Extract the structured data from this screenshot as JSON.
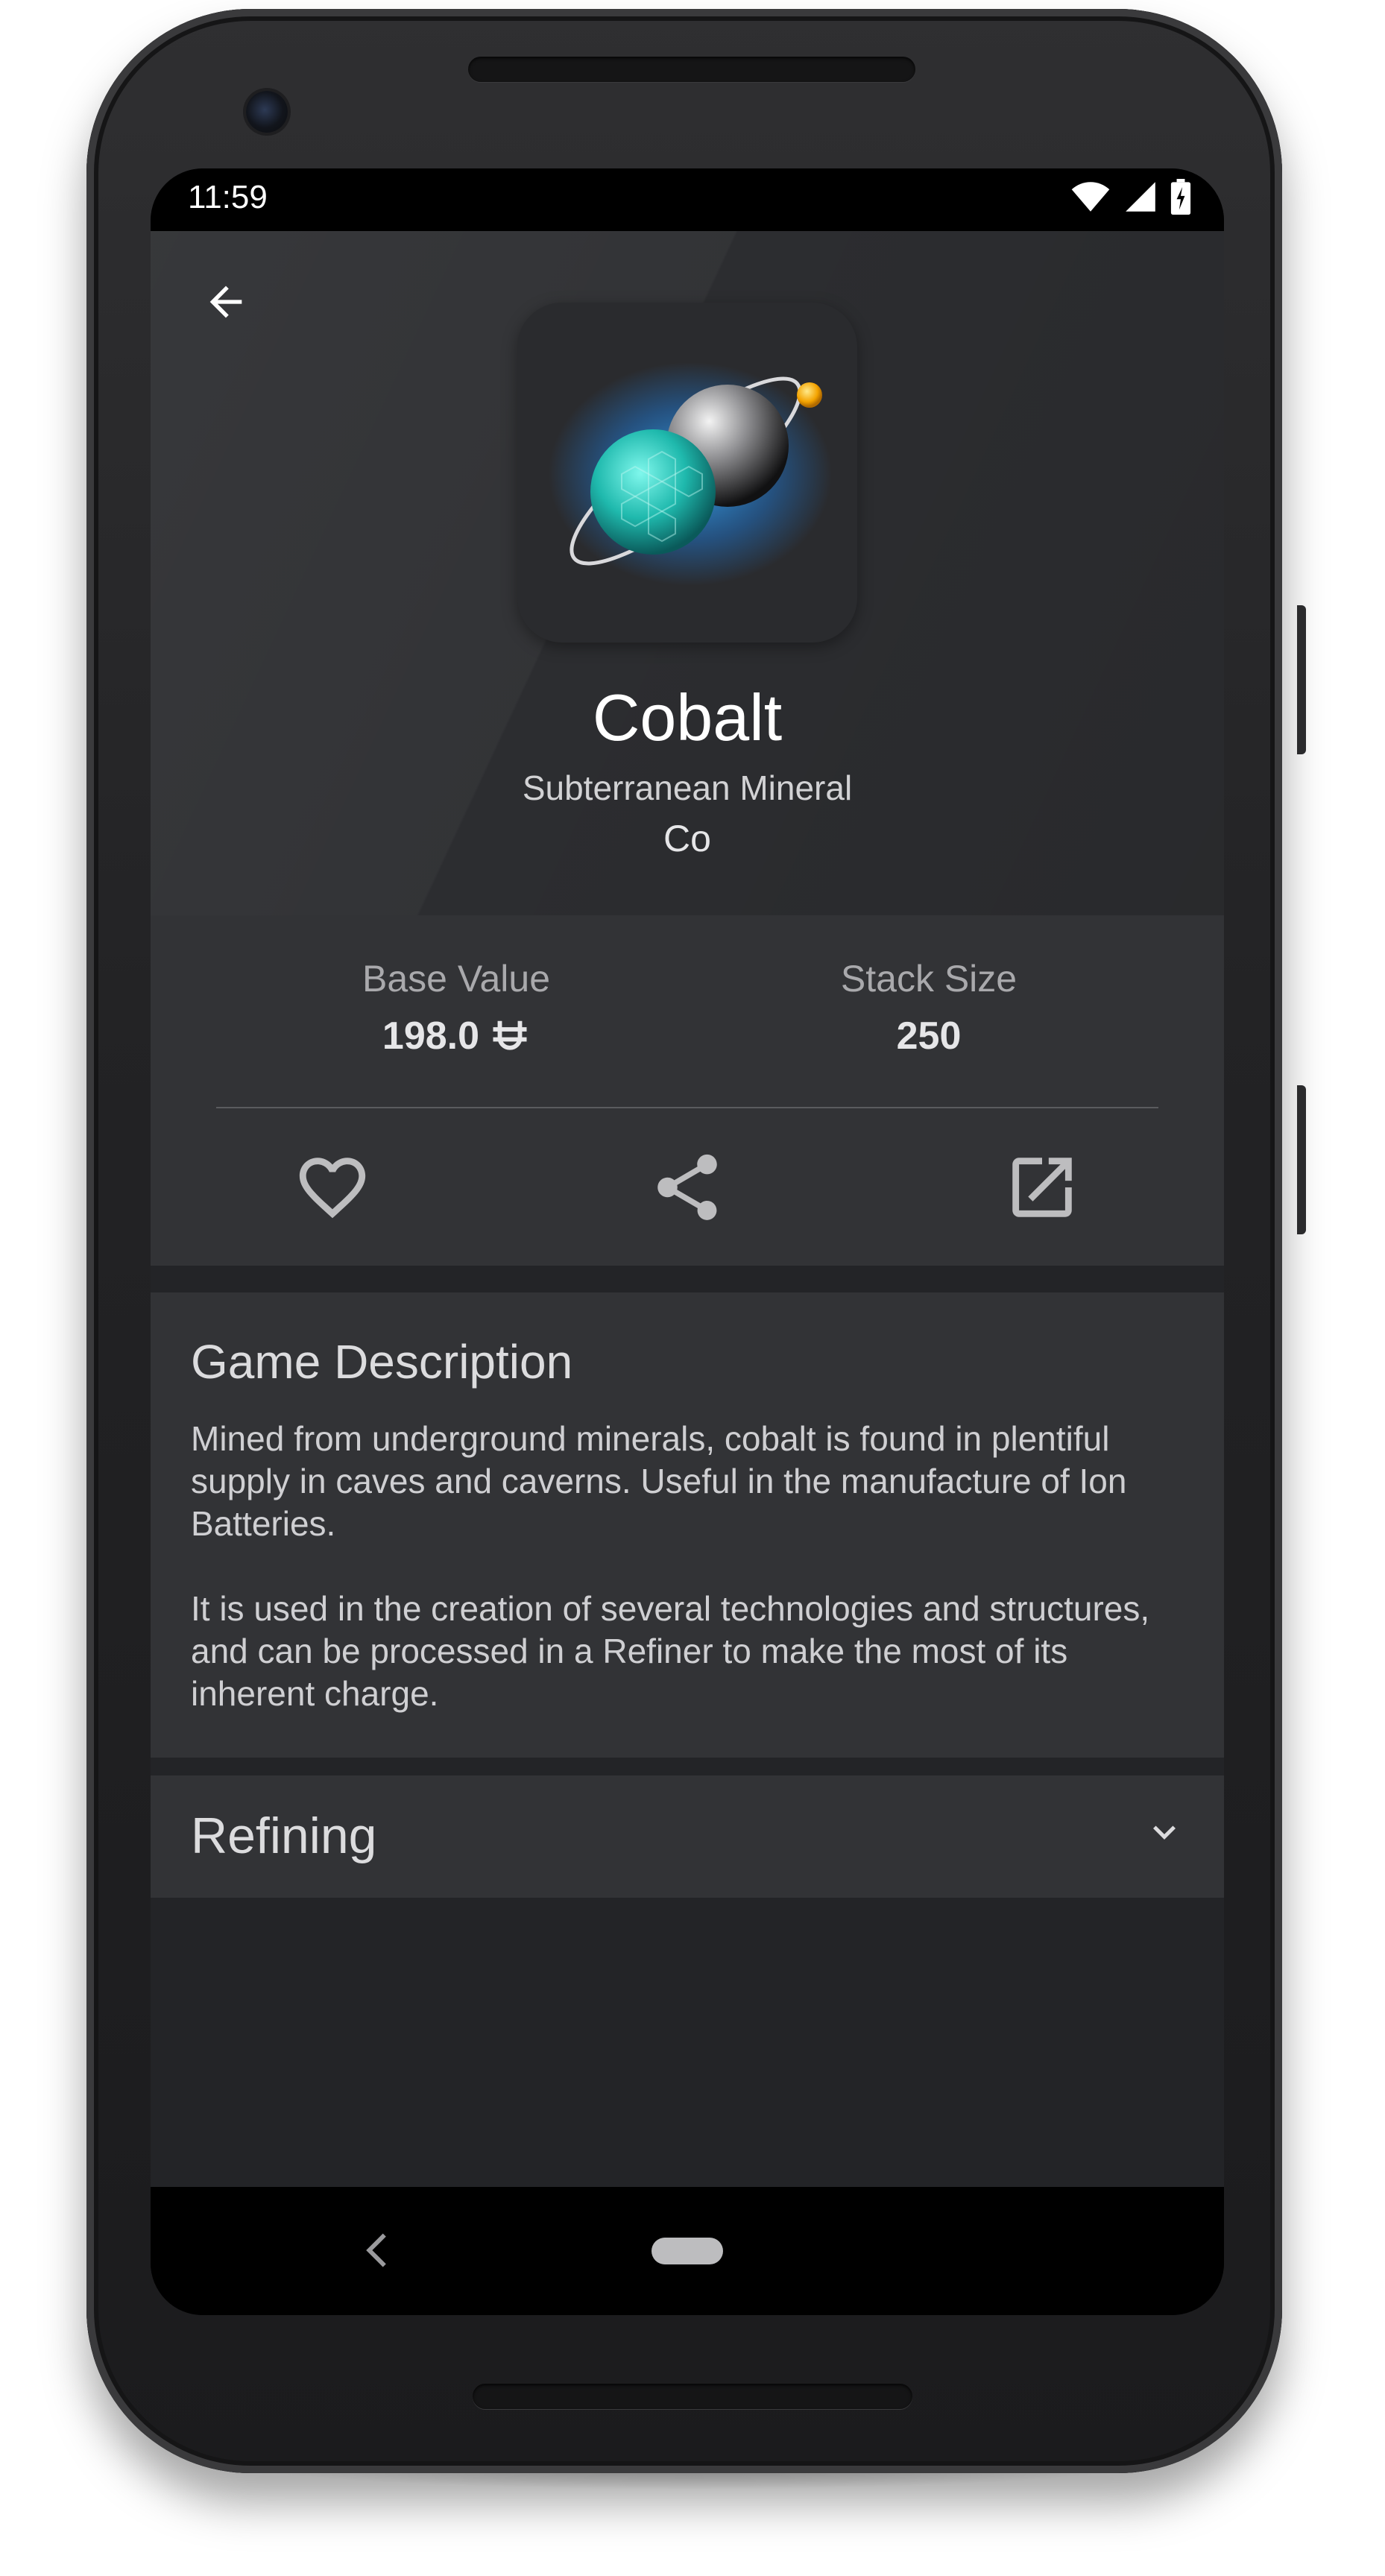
{
  "status_bar": {
    "time": "11:59",
    "icons": [
      "wifi-icon",
      "signal-icon",
      "battery-charging-icon"
    ]
  },
  "item": {
    "name": "Cobalt",
    "category": "Subterranean Mineral",
    "symbol": "Co",
    "icon": "cobalt-planet-icon"
  },
  "stats": {
    "base_value_label": "Base Value",
    "base_value": "198.0",
    "currency_icon": "units-currency-icon",
    "stack_size_label": "Stack Size",
    "stack_size": "250"
  },
  "actions": [
    "heart-icon",
    "share-icon",
    "open-external-icon"
  ],
  "description": {
    "title": "Game Description",
    "paragraph_1": "Mined from underground minerals, cobalt is found in plentiful supply in caves and caverns. Useful in the manufacture of Ion Batteries.",
    "paragraph_2": "It is used in the creation of several technologies and structures, and can be processed in a Refiner to make the most of its inherent charge."
  },
  "refining": {
    "title": "Refining",
    "expanded": false
  },
  "colors": {
    "background": "#232427",
    "card": "#323336",
    "text_primary": "#ffffff",
    "text_secondary": "#a9a9ac",
    "icon": "#bdbdbf"
  }
}
